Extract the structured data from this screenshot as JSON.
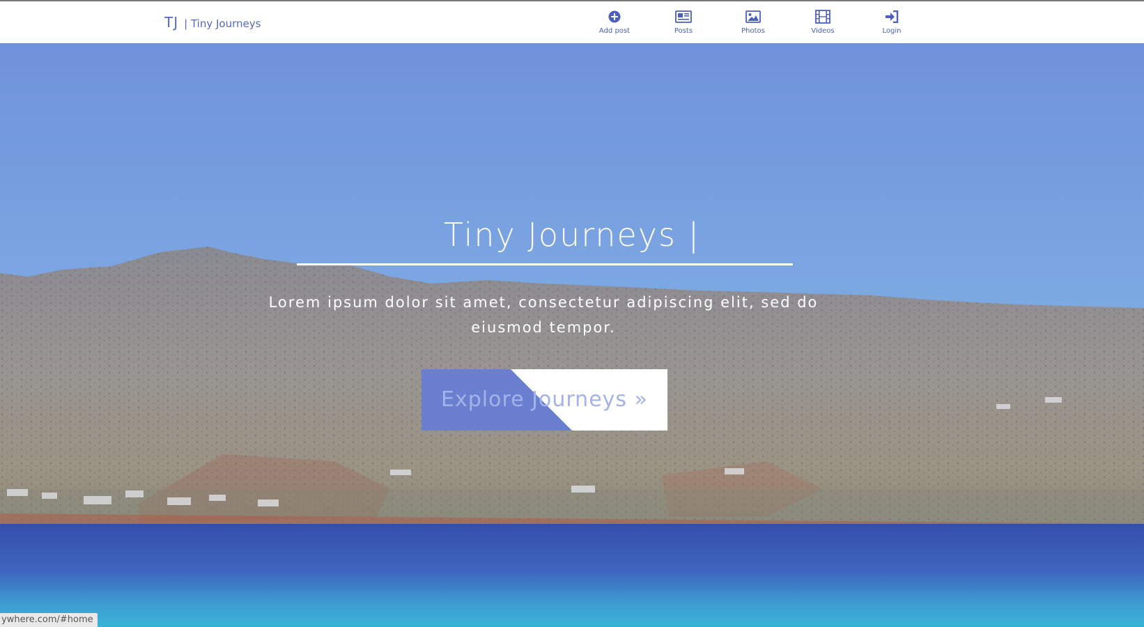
{
  "navbar": {
    "brand_mark": "TJ",
    "brand_name": "| Tiny Journeys",
    "items": [
      {
        "label": "Add post",
        "icon": "plus-circle-icon"
      },
      {
        "label": "Posts",
        "icon": "newspaper-icon"
      },
      {
        "label": "Photos",
        "icon": "image-icon"
      },
      {
        "label": "Videos",
        "icon": "film-icon"
      },
      {
        "label": "Login",
        "icon": "sign-in-icon"
      }
    ]
  },
  "hero": {
    "title": "Tiny Journeys |",
    "subtitle": "Lorem ipsum dolor sit amet, consectetur adipiscing elit, sed do eiusmod tempor.",
    "cta_label": "Explore Journeys »"
  },
  "status_bar": {
    "url": "ywhere.com/#home"
  },
  "colors": {
    "accent": "#5469c8",
    "cta_fill": "#6a7fcf",
    "cta_text": "#a3b2e8",
    "sky": "#7aa6e0",
    "sea": "#3556b8"
  }
}
